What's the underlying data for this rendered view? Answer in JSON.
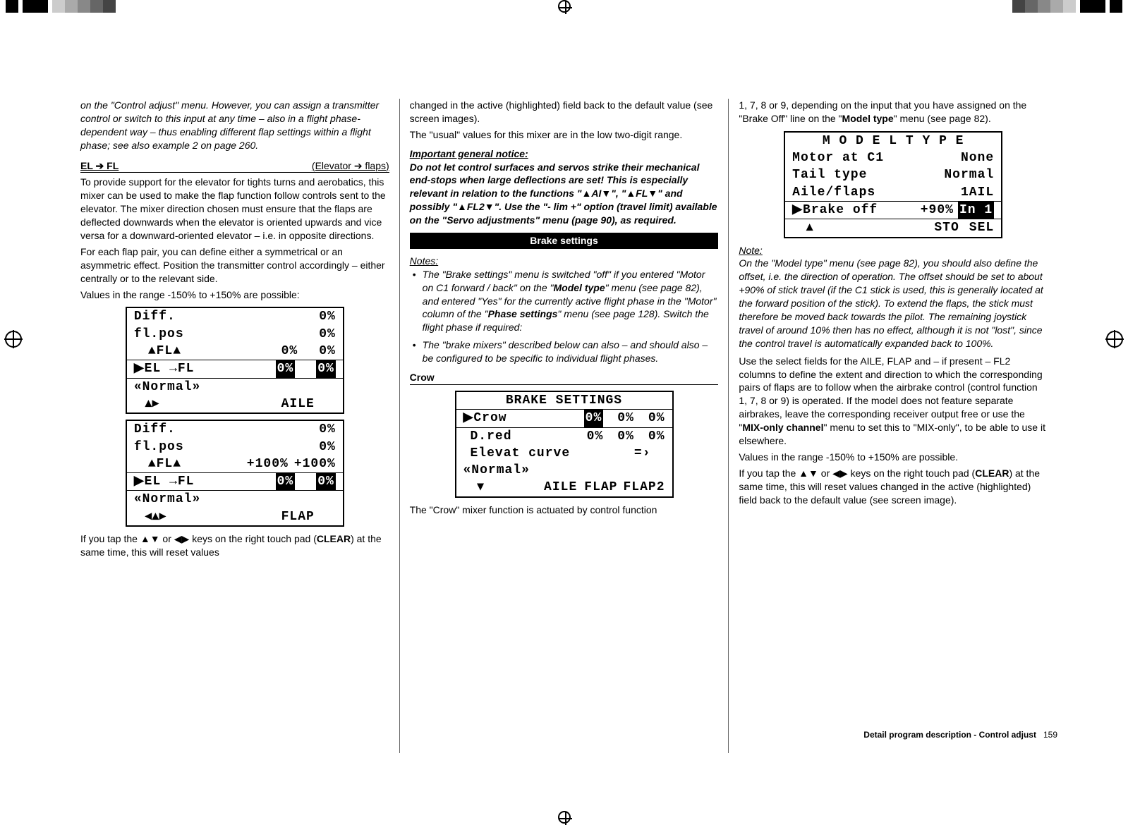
{
  "col1": {
    "p1": "on the \"Control adjust\" menu. However, you can assign a transmitter control or switch to this input at any time – also in a flight phase-dependent way – thus enabling different flap settings within a flight phase; see also example 2 on page 260.",
    "mixer_left": "EL ➔ FL",
    "mixer_right": "(Elevator ➔ flaps)",
    "p2": "To provide support for the elevator for tights turns and aerobatics, this mixer can be used to make the flap function follow controls sent to the elevator. The mixer direction chosen must ensure that the flaps are deflected downwards when the elevator is oriented upwards and vice versa for a downward-oriented elevator – i.e. in opposite directions.",
    "p3": "For each flap pair, you can define either a symmetrical or an asymmetric effect. Position the transmitter control accordingly – either centrally or to the relevant side.",
    "p4": "Values in the range -150% to +150% are possible:",
    "lcd1": {
      "r1a": "Diff.",
      "r1b": "0%",
      "r2a": "fl.pos",
      "r2b": "0%",
      "r3a": "▲FL▲",
      "r3b": "0%",
      "r3c": "0%",
      "r4a": "▶EL →FL",
      "r4b": "0%",
      "r4c": "0%",
      "r5": "«Normal»",
      "r6a": "▴▸",
      "r6b": "AILE"
    },
    "lcd2": {
      "r1a": "Diff.",
      "r1b": "0%",
      "r2a": "fl.pos",
      "r2b": "0%",
      "r3a": "▲FL▲",
      "r3b": "+100%",
      "r3c": "+100%",
      "r4a": "▶EL →FL",
      "r4b": "0%",
      "r4c": "0%",
      "r5": "«Normal»",
      "r6a": "◂▴▸",
      "r6b": "FLAP"
    },
    "p5a": "If you tap the ▲▼ or ◀▶ keys on the right touch pad (",
    "p5b": "CLEAR",
    "p5c": ") at the same time, this will reset values"
  },
  "col2": {
    "p1": "changed in the active (highlighted) field back to the default value (see screen images).",
    "p2": "The \"usual\" values for this mixer are in the low two-digit range.",
    "notice_head": "Important general notice:",
    "notice": "Do not let control surfaces and servos strike their mechanical end-stops when large deflections are set! This is especially relevant in relation to the functions \"▲AI▼\", \"▲FL▼\" and possibly \"▲FL2▼\". Use the \"- lim +\" option (travel limit) available on the \"Servo adjustments\" menu (page 90), as required.",
    "brake_bar": "Brake settings",
    "notes_head": "Notes:",
    "b1a": "The \"Brake settings\" menu is switched \"off\" if you entered \"Motor on C1 forward / back\" on the \"",
    "b1b": "Model type",
    "b1c": "\" menu (see page 82), and entered \"Yes\" for the currently active flight phase in the \"Motor\" column of the \"",
    "b1d": "Phase settings",
    "b1e": "\" menu (see page 128). Switch the flight phase if required:",
    "b2": "The \"brake mixers\" described below can also – and should also – be configured to be specific to individual flight phases.",
    "crow_head": "Crow",
    "lcd": {
      "title": "BRAKE SETTINGS",
      "r1a": "▶Crow",
      "r1b": "0%",
      "r1c": "0%",
      "r1d": "0%",
      "r2a": "D.red",
      "r2b": "0%",
      "r2c": "0%",
      "r2d": "0%",
      "r3a": "Elevat curve",
      "r3b": "=›",
      "r4": "«Normal»",
      "r5a": "▾",
      "r5b": "AILE",
      "r5c": "FLAP",
      "r5d": "FLAP2"
    },
    "p3": "The \"Crow\" mixer function is actuated by control function"
  },
  "col3": {
    "p1a": "1, 7, 8 or 9, depending on the input that you have assigned on the \"Brake Off\" line on the \"",
    "p1b": "Model type",
    "p1c": "\" menu (see page 82).",
    "lcd": {
      "title": "M O D E L T Y P E",
      "r1a": "Motor at C1",
      "r1b": "None",
      "r2a": "Tail type",
      "r2b": "Normal",
      "r3a": "Aile/flaps",
      "r3b": "1AIL",
      "r4a": "▶Brake off",
      "r4b": "+90%",
      "r4c": "In 1",
      "r5a": "▴",
      "r5b": "STO",
      "r5c": "SEL"
    },
    "note_head": "Note:",
    "note": "On the \"Model type\" menu (see page 82), you should also define the offset, i.e. the direction of operation. The offset should be set to about +90% of stick travel (if the C1 stick is used, this is generally located at the forward position of the stick). To extend the flaps, the stick must therefore be moved back towards the pilot. The remaining joystick travel of around 10% then has no effect, although it is not \"lost\", since the control travel is automatically expanded back to 100%.",
    "p2a": "Use the select fields for the AILE, FLAP and – if present – FL2 columns to define the extent and direction to which the corresponding pairs of flaps are to follow when the airbrake control (control function 1, 7, 8 or 9) is operated. If the model does not feature separate airbrakes, leave the corresponding receiver output free or use the \"",
    "p2b": "MIX-only channel",
    "p2c": "\" menu to set this to \"MIX-only\", to be able to use it elsewhere.",
    "p3": "Values in the range -150% to +150% are possible.",
    "p4a": "If you tap the ▲▼ or ◀▶ keys on the right touch pad (",
    "p4b": "CLEAR",
    "p4c": ") at the same time, this will reset values changed in the active (highlighted) field back to the default value (see screen image).",
    "footer_a": "Detail program description - Control adjust",
    "footer_b": "159"
  }
}
